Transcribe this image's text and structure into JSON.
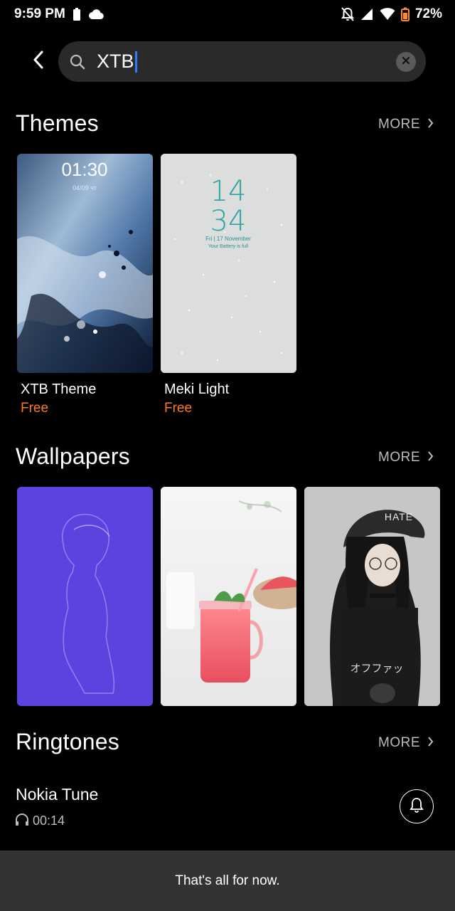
{
  "status_bar": {
    "time": "9:59 PM",
    "battery": "72%",
    "icons": [
      "battery-saver-icon",
      "cloud-icon",
      "notifications-off-icon",
      "signal-icon",
      "wifi-icon",
      "battery-icon"
    ]
  },
  "search": {
    "query": "XTB",
    "icons": [
      "back-arrow-icon",
      "search-icon",
      "clear-icon"
    ]
  },
  "themes": {
    "title": "Themes",
    "more_label": "MORE",
    "items": [
      {
        "name": "XTB Theme",
        "price": "Free",
        "preview_time": "01:30",
        "preview_date": "04/09 чт"
      },
      {
        "name": "Meki Light",
        "price": "Free",
        "preview_hour": "14",
        "preview_min": "34",
        "preview_date": "Fri | 17 November",
        "preview_status": "Your Battery is full"
      }
    ]
  },
  "wallpapers": {
    "title": "Wallpapers",
    "more_label": "MORE",
    "items": [
      {
        "description": "purple-silhouette"
      },
      {
        "description": "watermelon-drink"
      },
      {
        "description": "anime-girl",
        "cap_text": "HATE",
        "shirt_text": "オフファッ"
      }
    ]
  },
  "ringtones": {
    "title": "Ringtones",
    "more_label": "MORE",
    "items": [
      {
        "name": "Nokia Tune",
        "duration": "00:14"
      }
    ]
  },
  "footer": {
    "message": "That's all for now."
  },
  "colors": {
    "accent_price": "#ff7a1a",
    "caret": "#2f7bff",
    "background": "#000000",
    "wallpaper_purple": "#5b43e0"
  }
}
